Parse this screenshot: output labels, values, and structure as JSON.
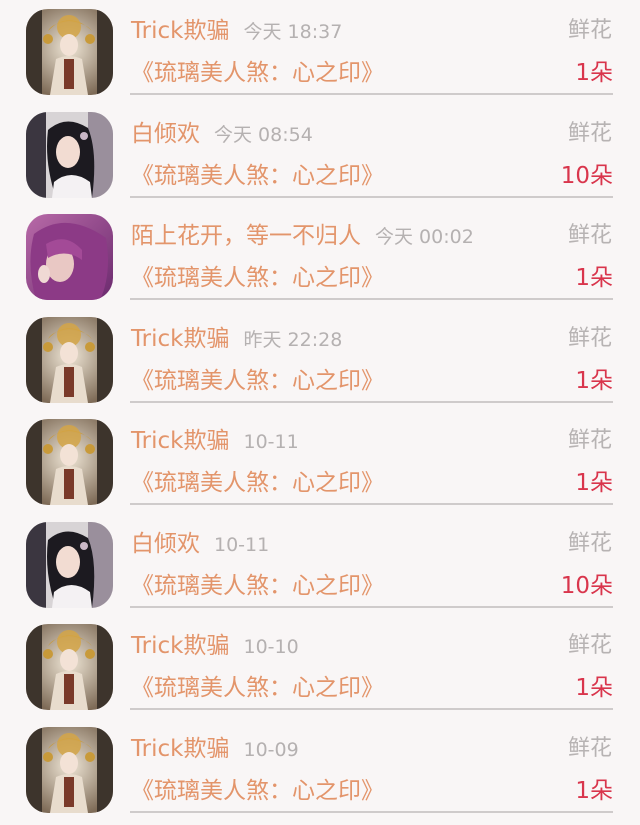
{
  "gift_records": [
    {
      "user": "Trick欺骗",
      "time": "今天 18:37",
      "gift_type": "鲜花",
      "book": "《琉璃美人煞：心之印》",
      "quantity": "1朵",
      "avatar_icon": "ancient-costume-portrait-icon"
    },
    {
      "user": "白倾欢",
      "time": "今天 08:54",
      "gift_type": "鲜花",
      "book": "《琉璃美人煞：心之印》",
      "quantity": "10朵",
      "avatar_icon": "girl-portrait-icon"
    },
    {
      "user": "陌上花开，等一不归人",
      "time": "今天 00:02",
      "gift_type": "鲜花",
      "book": "《琉璃美人煞：心之印》",
      "quantity": "1朵",
      "avatar_icon": "purple-hair-girl-icon"
    },
    {
      "user": "Trick欺骗",
      "time": "昨天 22:28",
      "gift_type": "鲜花",
      "book": "《琉璃美人煞：心之印》",
      "quantity": "1朵",
      "avatar_icon": "ancient-costume-portrait-icon"
    },
    {
      "user": "Trick欺骗",
      "time": "10-11",
      "gift_type": "鲜花",
      "book": "《琉璃美人煞：心之印》",
      "quantity": "1朵",
      "avatar_icon": "ancient-costume-portrait-icon"
    },
    {
      "user": "白倾欢",
      "time": "10-11",
      "gift_type": "鲜花",
      "book": "《琉璃美人煞：心之印》",
      "quantity": "10朵",
      "avatar_icon": "girl-portrait-icon"
    },
    {
      "user": "Trick欺骗",
      "time": "10-10",
      "gift_type": "鲜花",
      "book": "《琉璃美人煞：心之印》",
      "quantity": "1朵",
      "avatar_icon": "ancient-costume-portrait-icon"
    },
    {
      "user": "Trick欺骗",
      "time": "10-09",
      "gift_type": "鲜花",
      "book": "《琉璃美人煞：心之印》",
      "quantity": "1朵",
      "avatar_icon": "ancient-costume-portrait-icon"
    }
  ],
  "colors": {
    "name": "#e3956b",
    "meta": "#b5b1b1",
    "quantity": "#d9354c",
    "divider": "#cfcbcb",
    "background": "#f9f6f6"
  }
}
